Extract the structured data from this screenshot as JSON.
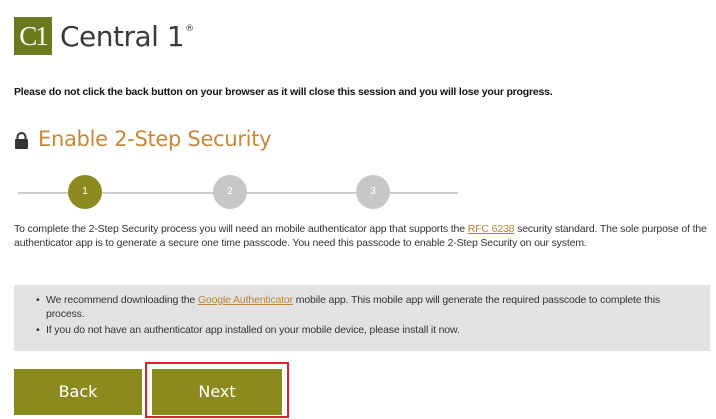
{
  "header": {
    "logo_mark": "C1",
    "brand": "Central 1",
    "trademark": "®"
  },
  "warning": "Please do not click the back button on your browser as it will close this session and you will lose your progress.",
  "title": "Enable 2-Step Security",
  "stepper": {
    "steps": [
      "1",
      "2",
      "3"
    ],
    "current_step": 1
  },
  "intro": {
    "part1": "To complete the 2-Step Security process you will need an mobile authenticator app that supports the ",
    "link": "RFC 6238",
    "part2": " security standard. The sole purpose of the authenticator app is to generate a secure one time passcode. You need this passcode to enable 2-Step Security on our system."
  },
  "infobox": {
    "item1_before": "We recommend downloading the ",
    "item1_link": "Google Authenticator",
    "item1_after": " mobile app. This mobile app will generate the required passcode to complete this process.",
    "item2": "If you do not have an authenticator app installed on your mobile device, please install it now."
  },
  "buttons": {
    "back": "Back",
    "next": "Next"
  },
  "colors": {
    "accent": "#8a8a1f",
    "title": "#c8883a",
    "link": "#b8862f",
    "highlight": "#d4262a"
  }
}
